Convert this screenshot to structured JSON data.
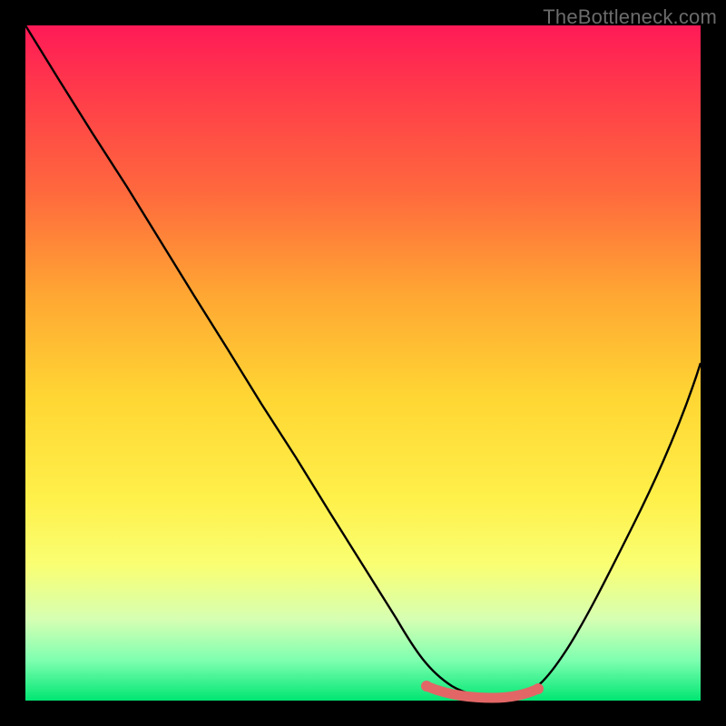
{
  "watermark": "TheBottleneck.com",
  "chart_data": {
    "type": "line",
    "title": "",
    "xlabel": "",
    "ylabel": "",
    "x": [
      0.0,
      0.05,
      0.1,
      0.15,
      0.2,
      0.25,
      0.3,
      0.35,
      0.4,
      0.45,
      0.5,
      0.55,
      0.6,
      0.63,
      0.67,
      0.7,
      0.73,
      0.76,
      0.8,
      0.85,
      0.9,
      0.95,
      1.0
    ],
    "values": [
      1.0,
      0.92,
      0.84,
      0.76,
      0.68,
      0.6,
      0.52,
      0.44,
      0.36,
      0.28,
      0.2,
      0.12,
      0.055,
      0.025,
      0.01,
      0.004,
      0.003,
      0.01,
      0.035,
      0.1,
      0.2,
      0.34,
      0.5
    ],
    "ylim": [
      0.0,
      1.0
    ],
    "xlim": [
      0.0,
      1.0
    ],
    "series_color": "#000000",
    "accent_region": {
      "x_start": 0.59,
      "x_end": 0.76,
      "color": "#e26666"
    },
    "background_gradient": [
      "#ff1a57",
      "#00e673"
    ]
  }
}
